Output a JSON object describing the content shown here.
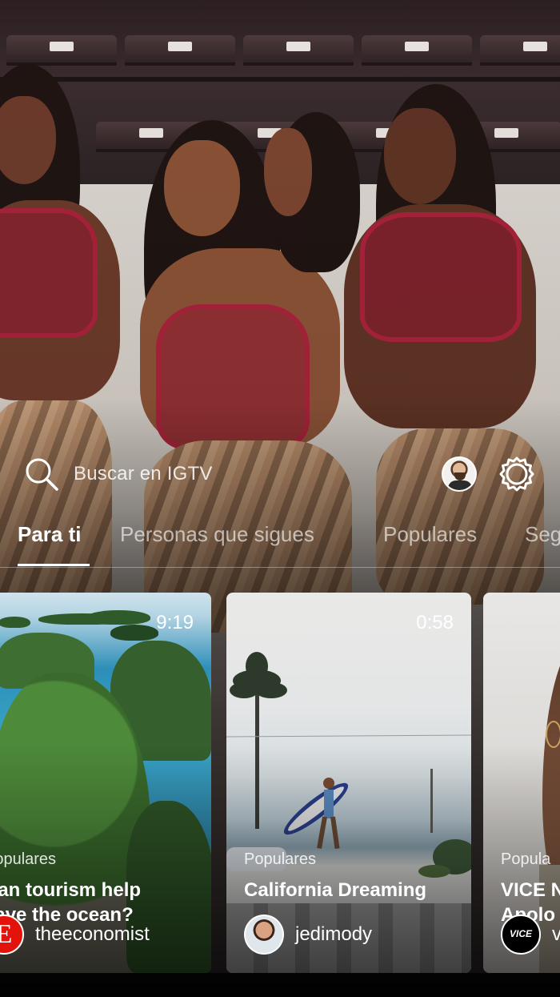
{
  "search": {
    "placeholder": "Buscar en IGTV"
  },
  "tabs": [
    {
      "label": "Para ti",
      "active": true
    },
    {
      "label": "Personas que sigues",
      "active": false
    },
    {
      "label": "Populares",
      "active": false
    },
    {
      "label": "Seg",
      "active": false
    }
  ],
  "cards": [
    {
      "duration": "9:19",
      "category": "Populares",
      "title_line1": "Can tourism help",
      "title_line2": "save the ocean?",
      "channel": "theeconomist",
      "channel_logo_letter": "E"
    },
    {
      "duration": "0:58",
      "category": "Populares",
      "title_line1": "California Dreaming",
      "title_line2": "",
      "channel": "jedimody"
    },
    {
      "duration": "",
      "category": "Popula",
      "title_line1": "VICE N",
      "title_line2": "Apolo",
      "channel": "v",
      "channel_logo_text": "VICE"
    }
  ],
  "colors": {
    "economist_red": "#e3120b",
    "costume_red": "#a8223a",
    "text_primary": "#ffffff"
  },
  "icons": [
    "search-icon",
    "profile-avatar",
    "settings-gear-icon"
  ]
}
